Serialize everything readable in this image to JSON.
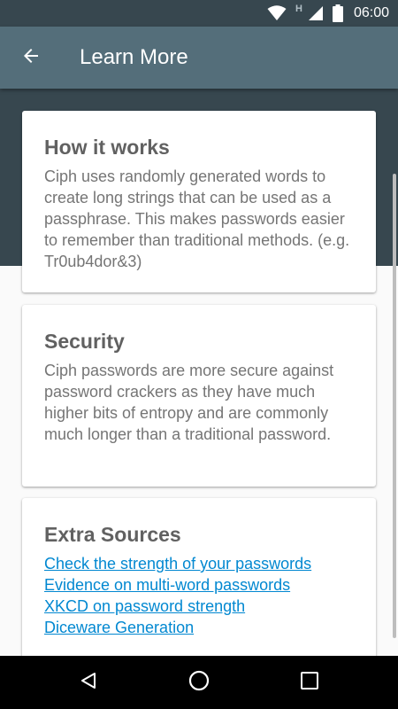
{
  "status_bar": {
    "time": "06:00",
    "network_badge": "H",
    "icons": [
      "wifi-icon",
      "cell-signal-icon",
      "battery-icon"
    ]
  },
  "app_bar": {
    "title": "Learn More",
    "back_icon": "arrow-left-icon"
  },
  "cards": [
    {
      "title": "How it works",
      "body": "Ciph uses randomly generated words to create long strings that can be used as a passphrase. This makes passwords easier to remember than traditional methods. (e.g. Tr0ub4dor&3)"
    },
    {
      "title": "Security",
      "body": "Ciph passwords are more secure against password crackers as they have much higher bits of entropy and are commonly much longer than a traditional password."
    },
    {
      "title": "Extra Sources",
      "links": [
        "Check the strength of your passwords",
        "Evidence on multi-word passwords",
        "XKCD on password strength",
        "Diceware Generation"
      ]
    }
  ],
  "nav_bar": {
    "icons": [
      "back-triangle-icon",
      "home-circle-icon",
      "recents-square-icon"
    ]
  },
  "colors": {
    "status_bar": "#37474f",
    "app_bar": "#546e7a",
    "link": "#0288d1"
  }
}
